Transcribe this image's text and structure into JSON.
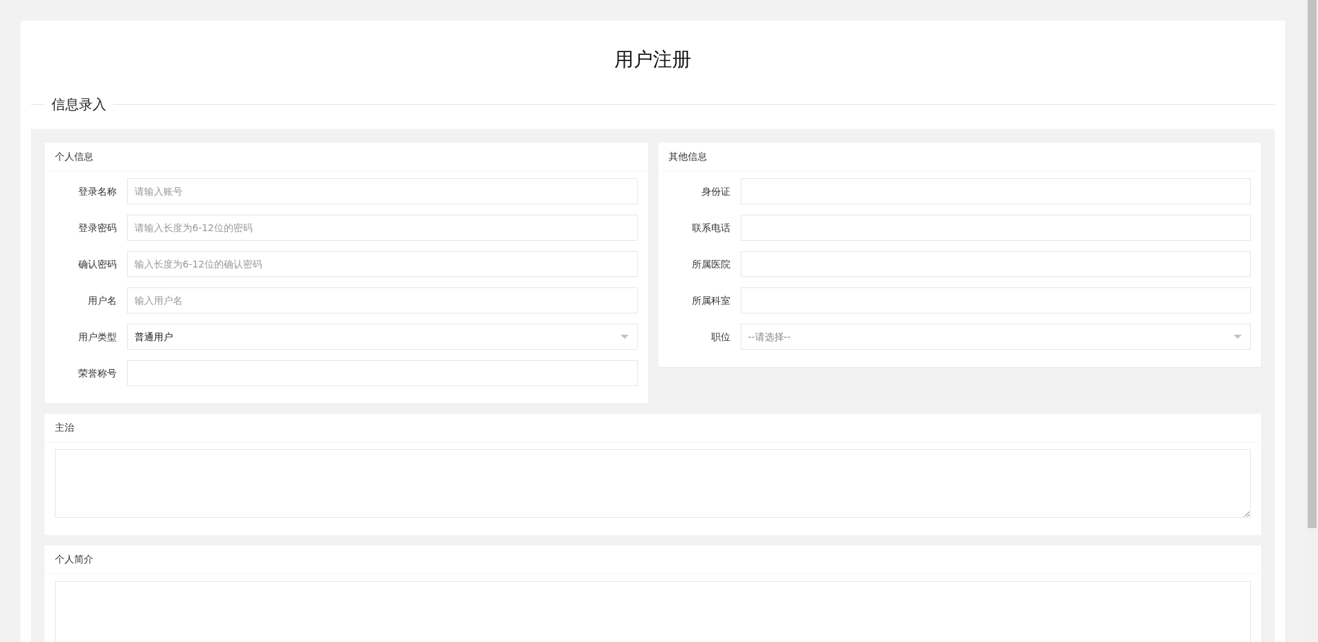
{
  "title": "用户注册",
  "section": {
    "legend": "信息录入"
  },
  "panels": [
    {
      "title": "个人信息",
      "fields": [
        {
          "kind": "input",
          "label": "登录名称",
          "placeholder": "请输入账号"
        },
        {
          "kind": "input",
          "label": "登录密码",
          "placeholder": "请输入长度为6-12位的密码"
        },
        {
          "kind": "input",
          "label": "确认密码",
          "placeholder": "输入长度为6-12位的确认密码"
        },
        {
          "kind": "input",
          "label": "用户名",
          "placeholder": "输入用户名"
        },
        {
          "kind": "select",
          "label": "用户类型",
          "value": "普通用户"
        },
        {
          "kind": "input",
          "label": "荣誉称号"
        }
      ]
    },
    {
      "title": "其他信息",
      "fields": [
        {
          "kind": "input",
          "label": "身份证"
        },
        {
          "kind": "input",
          "label": "联系电话"
        },
        {
          "kind": "input",
          "label": "所属医院"
        },
        {
          "kind": "input",
          "label": "所属科室"
        },
        {
          "kind": "select",
          "label": "职位",
          "placeholder": "--请选择--"
        }
      ]
    }
  ],
  "text_panels": [
    {
      "title": "主治"
    },
    {
      "title": "个人简介"
    }
  ]
}
